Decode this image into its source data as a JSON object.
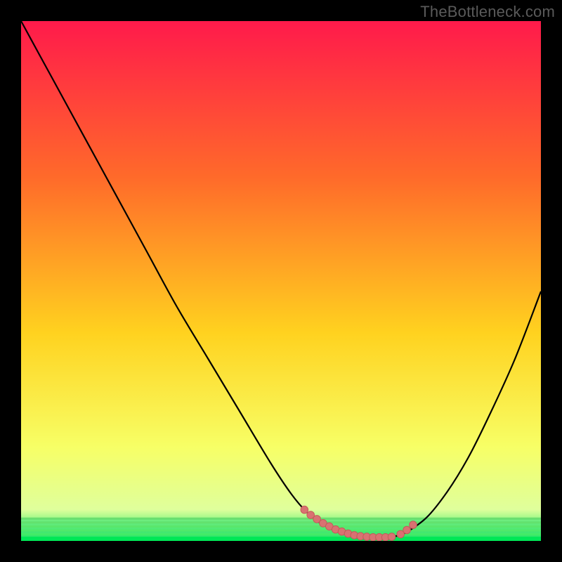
{
  "watermark": "TheBottleneck.com",
  "colors": {
    "bg_black": "#000000",
    "grad_top": "#ff1a4b",
    "grad_upper_mid": "#ff6a2a",
    "grad_mid": "#ffd21f",
    "grad_lower_mid": "#f7ff66",
    "grad_green": "#00e756",
    "curve_stroke": "#000000",
    "bead_fill": "#d97272",
    "bead_stroke": "#c55a5a"
  },
  "chart_data": {
    "type": "line",
    "title": "",
    "xlabel": "",
    "ylabel": "",
    "xlim": [
      0,
      100
    ],
    "ylim": [
      0,
      100
    ],
    "series": [
      {
        "name": "main-curve",
        "x": [
          0,
          6,
          12,
          18,
          24,
          30,
          36,
          42,
          48,
          52,
          55,
          58,
          62,
          66,
          70,
          72,
          74,
          78,
          82,
          86,
          90,
          95,
          100
        ],
        "y": [
          100,
          89,
          78,
          67,
          56,
          45,
          35,
          25,
          15,
          9,
          5.5,
          3.2,
          1.6,
          0.9,
          0.7,
          0.9,
          1.6,
          4.5,
          9.5,
          16,
          24,
          35,
          48
        ]
      },
      {
        "name": "highlight-beads-left",
        "x": [
          54.5,
          55.7,
          56.9,
          58.1,
          59.3,
          60.5,
          61.7,
          62.9,
          64.1,
          65.3,
          66.5,
          67.7,
          68.9,
          70.1,
          71.3
        ],
        "y": [
          6.0,
          5.0,
          4.2,
          3.4,
          2.8,
          2.2,
          1.8,
          1.4,
          1.1,
          0.9,
          0.8,
          0.7,
          0.7,
          0.7,
          0.8
        ]
      },
      {
        "name": "highlight-beads-right",
        "x": [
          73.0,
          74.2,
          75.4
        ],
        "y": [
          1.3,
          2.1,
          3.1
        ]
      }
    ],
    "gradient_bands_y": [
      100,
      75,
      45,
      18,
      8,
      4,
      0
    ],
    "annotations": []
  }
}
